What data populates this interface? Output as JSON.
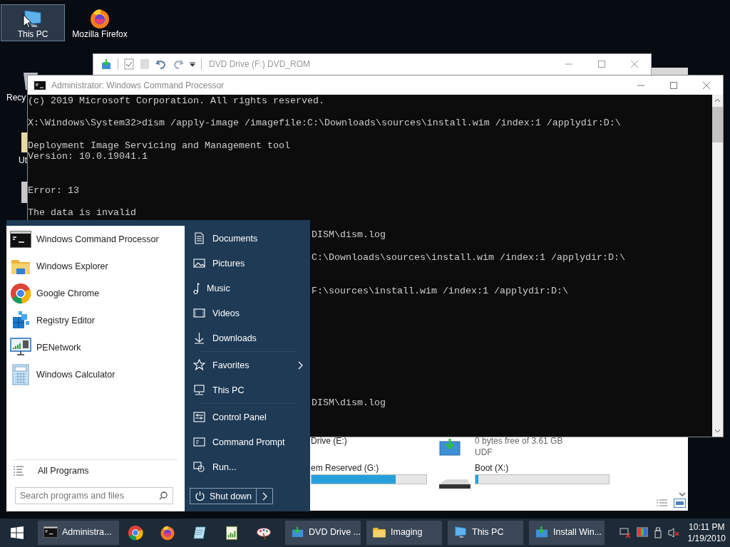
{
  "desktop_icons": [
    {
      "label": "This PC",
      "kind": "pc",
      "selected": true
    },
    {
      "label": "Mozilla Firefox",
      "kind": "firefox",
      "selected": false
    }
  ],
  "desktop_partial_labels": [
    "Recy",
    "Ut"
  ],
  "explorer_window": {
    "title": "DVD Drive (F:) DVD_ROM"
  },
  "drives_window": {
    "tiles": [
      {
        "name": "Drive (E:)"
      },
      {
        "kind": "dvd",
        "details": [
          "0 bytes free of 3.61 GB",
          "UDF"
        ]
      },
      {
        "name": "em Reserved (G:)",
        "level": 0.73
      },
      {
        "kind": "hdd",
        "name": "Boot (X:)",
        "level": 0.02
      }
    ]
  },
  "cmd_window": {
    "title": "Administrator: Windows Command Processor",
    "lines": [
      {
        "kind": "text",
        "text": "(c) 2019 Microsoft Corporation. All rights reserved."
      },
      {
        "kind": "blank"
      },
      {
        "kind": "text",
        "text": "X:\\Windows\\System32>dism /apply-image /imagefile:C:\\Downloads\\sources\\install.wim /index:1 /applydir:D:\\"
      },
      {
        "kind": "blank"
      },
      {
        "kind": "text",
        "text": "Deployment Image Servicing and Management tool"
      },
      {
        "kind": "text",
        "text": "Version: 10.0.19041.1"
      },
      {
        "kind": "blank"
      },
      {
        "kind": "blank"
      },
      {
        "kind": "text",
        "text": "Error: 13"
      },
      {
        "kind": "blank"
      },
      {
        "kind": "text",
        "text": "The data is invalid"
      },
      {
        "kind": "blank"
      },
      {
        "kind": "tail",
        "text": "DISM\\dism.log"
      },
      {
        "kind": "blank"
      },
      {
        "kind": "tail",
        "text": "C:\\Downloads\\sources\\install.wim /index:1 /applydir:D:\\"
      },
      {
        "kind": "blank"
      },
      {
        "kind": "blank"
      },
      {
        "kind": "tail",
        "text": "F:\\sources\\install.wim /index:1 /applydir:D:\\"
      },
      {
        "kind": "blank"
      },
      {
        "kind": "blank"
      },
      {
        "kind": "blank"
      },
      {
        "kind": "blank"
      },
      {
        "kind": "blank"
      },
      {
        "kind": "blank"
      },
      {
        "kind": "blank"
      },
      {
        "kind": "blank"
      },
      {
        "kind": "blank"
      },
      {
        "kind": "tail",
        "text": "DISM\\dism.log"
      }
    ]
  },
  "start_menu": {
    "programs": [
      {
        "label": "Windows Command Processor",
        "kind": "cmd"
      },
      {
        "label": "Windows Explorer",
        "kind": "explorer"
      },
      {
        "label": "Google Chrome",
        "kind": "chrome"
      },
      {
        "label": "Registry Editor",
        "kind": "registry"
      },
      {
        "label": "PENetwork",
        "kind": "network"
      },
      {
        "label": "Windows Calculator",
        "kind": "calculator"
      }
    ],
    "all_programs": "All Programs",
    "search": {
      "placeholder": "Search programs and files"
    },
    "places": [
      [
        {
          "label": "Documents",
          "kind": "documents",
          "submenu": false
        },
        {
          "label": "Pictures",
          "kind": "pictures",
          "submenu": false
        },
        {
          "label": "Music",
          "kind": "music",
          "submenu": false
        },
        {
          "label": "Videos",
          "kind": "videos",
          "submenu": false
        },
        {
          "label": "Downloads",
          "kind": "downloads",
          "submenu": false
        }
      ],
      [
        {
          "label": "Favorites",
          "kind": "favorites",
          "submenu": true
        },
        {
          "label": "This PC",
          "kind": "pc",
          "submenu": false
        }
      ],
      [
        {
          "label": "Control Panel",
          "kind": "control",
          "submenu": false
        },
        {
          "label": "Command Prompt",
          "kind": "prompt",
          "submenu": false
        },
        {
          "label": "Run...",
          "kind": "run",
          "submenu": false
        }
      ]
    ],
    "shutdown": "Shut down"
  },
  "taskbar": {
    "items": [
      {
        "kind": "cmd",
        "label": "Administra...",
        "selected": false
      },
      {
        "kind": "chrome",
        "selected": false
      },
      {
        "kind": "firefox",
        "selected": false
      },
      {
        "kind": "notepad",
        "selected": false
      },
      {
        "kind": "chart",
        "selected": false
      },
      {
        "kind": "paint",
        "selected": false
      },
      {
        "kind": "setup",
        "label": "DVD Drive ...",
        "selected": false
      },
      {
        "kind": "folder",
        "label": "Imaging",
        "selected": false
      },
      {
        "kind": "pc",
        "label": "This PC",
        "selected": false
      },
      {
        "kind": "setup",
        "label": "Install Win...",
        "selected": false
      }
    ],
    "time": "10:11 PM",
    "date": "1/19/2010"
  }
}
